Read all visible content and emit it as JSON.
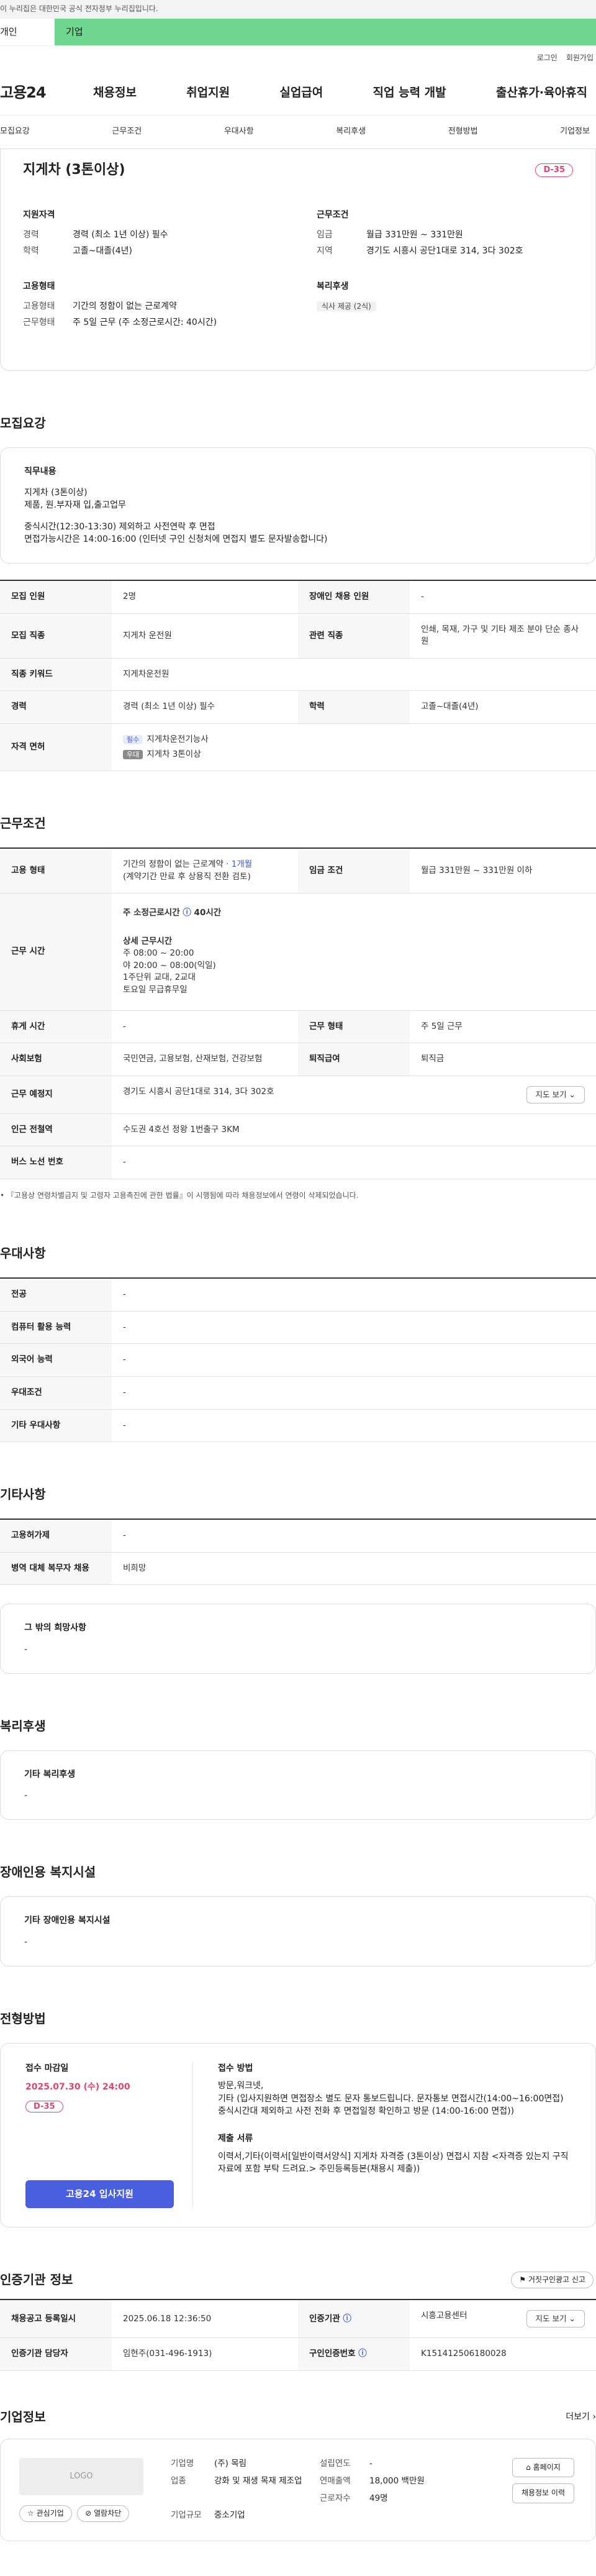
{
  "gov_banner": "이 누리집은 대한민국 공식 전자정부 누리집입니다.",
  "top_tabs": [
    "개인",
    "기업"
  ],
  "util": [
    "로그인",
    "회원가입"
  ],
  "logo": "고용24",
  "gnb": [
    "채용정보",
    "취업지원",
    "실업급여",
    "직업 능력 개발",
    "출산휴가·육아휴직"
  ],
  "subnav": [
    "모집요강",
    "근무조건",
    "우대사항",
    "복리후생",
    "전형방법",
    "기업정보"
  ],
  "summary": {
    "title": "지게차 (3톤이상)",
    "dday": "D-35",
    "req_title": "지원자격",
    "req": [
      {
        "k": "경력",
        "v": "경력 (최소 1년 이상) 필수"
      },
      {
        "k": "학력",
        "v": "고졸~대졸(4년)"
      }
    ],
    "cond_title": "근무조건",
    "cond": [
      {
        "k": "임금",
        "v": "월급 331만원 ~ 331만원"
      },
      {
        "k": "지역",
        "v": "경기도 시흥시 공단1대로 314, 3다 302호"
      }
    ],
    "emp_title": "고용형태",
    "emp": [
      {
        "k": "고용형태",
        "v": "기간의 정함이 없는 근로계약"
      },
      {
        "k": "근무형태",
        "v": "주 5일 근무 (주 소정근로시간: 40시간)"
      }
    ],
    "welfare_title": "복리후생",
    "welfare_chip": "식사 제공 (2식)"
  },
  "recruit": {
    "title": "모집요강",
    "duty_title": "직무내용",
    "duty_lines": [
      "지게차 (3톤이상)",
      "제품, 원.부자재  입,출고업무",
      "",
      "중식시간(12:30-13:30) 제외하고 사전연락 후 면접",
      "면접가능시간은 14:00-16:00 (인터넷 구인 신청처에 면접지 별도 문자발송합니다)"
    ],
    "rows": [
      {
        "k1": "모집 인원",
        "v1": "2명",
        "k2": "장애인 채용 인원",
        "v2": "-"
      },
      {
        "k1": "모집 직종",
        "v1": "지게차 운전원",
        "k2": "관련 직종",
        "v2": "인쇄, 목재, 가구 및 기타 제조 분야 단순 종사원"
      },
      {
        "k1": "직종 키워드",
        "v1": "지게차운전원"
      },
      {
        "k1": "경력",
        "v1": "경력 (최소 1년 이상) 필수",
        "k2": "학력",
        "v2": "고졸~대졸(4년)"
      }
    ],
    "license_label": "자격 면허",
    "license": [
      {
        "tag": "필수",
        "name": "지게차운전기능사"
      },
      {
        "tag": "우대",
        "name": "지게차 3톤이상"
      }
    ]
  },
  "work": {
    "title": "근무조건",
    "emp_label": "고용 형태",
    "emp_v1": "기간의 정함이 없는 근로계약",
    "emp_v1_blue": " · 1개월",
    "emp_v2": "(계약기간 만료 후 상용직 전환 검토)",
    "wage_label": "임금 조건",
    "wage": "월급 331만원 ~ 331만원 이하",
    "hours_label": "근무 시간",
    "hours_head": "주 소정근로시간",
    "hours_head2": "40시간",
    "hours_detail_title": "상세 근무시간",
    "hours_lines": [
      "주 08:00 ~ 20:00",
      "야 20:00 ~ 08:00(익일)",
      "1주단위 교대, 2교대",
      "토요일 무급휴무일"
    ],
    "rows": [
      {
        "k1": "휴게 시간",
        "v1": "-",
        "k2": "근무 형태",
        "v2": "주 5일 근무"
      },
      {
        "k1": "사회보험",
        "v1": "국민연금, 고용보험, 산재보험, 건강보험",
        "k2": "퇴직급여",
        "v2": "퇴직금"
      }
    ],
    "place_label": "근무 예정지",
    "place": "경기도 시흥시 공단1대로 314, 3다 302호",
    "map_btn": "지도 보기",
    "subway_label": "인근 전철역",
    "subway": "수도권 4호선 정왕 1번출구 3KM",
    "bus_label": "버스 노선 번호",
    "bus": "-",
    "note": "『고용상 연령차별금지 및 고령자 고용촉진에 관한 법률』이 시행됨에 따라 채용정보에서 연령이 삭제되었습니다."
  },
  "prefer": {
    "title": "우대사항",
    "rows": [
      {
        "k": "전공",
        "v": "-"
      },
      {
        "k": "컴퓨터 활용 능력",
        "v": "-"
      },
      {
        "k": "외국어 능력",
        "v": "-"
      },
      {
        "k": "우대조건",
        "v": "-"
      },
      {
        "k": "기타 우대사항",
        "v": "-"
      }
    ]
  },
  "etc": {
    "title": "기타사항",
    "rows": [
      {
        "k": "고용허가제",
        "v": "-"
      },
      {
        "k": "병역 대체 복무자 채용",
        "v": "비희망"
      }
    ],
    "box_title": "그 밖의 희망사항",
    "box_value": "-"
  },
  "welfare": {
    "title": "복리후생",
    "box_title": "기타 복리후생",
    "box_value": "-"
  },
  "disabled": {
    "title": "장애인용 복지시설",
    "box_title": "기타 장애인용 복지시설",
    "box_value": "-"
  },
  "apply": {
    "title": "전형방법",
    "deadline_label": "접수 마감일",
    "deadline": "2025.07.30 (수) 24:00",
    "dday": "D-35",
    "button": "고용24 입사지원",
    "method_title": "접수 방법",
    "method_lines": [
      "방문,워크넷,",
      "기타 (입사지원하면 면접장소 별도 문자 통보드립니다. 문자통보 면접시간(14:00~16:00면접) 중식시간대 제외하고 사전 전화 후 면접일정 확인하고 방문 (14:00-16:00 면접))"
    ],
    "docs_title": "제출 서류",
    "docs_lines": [
      "이력서,기타(이력서[일반이력서양식] 지게차 자격증 (3톤이상) 면접시 지참 <자격증 있는지 구직 자료에 포함 부탁 드려요.> 주민등록등본(채용시 제출))"
    ]
  },
  "cert": {
    "title": "인증기관 정보",
    "report_btn": "거짓구인광고 신고",
    "reg_label": "채용공고 등록일시",
    "reg": "2025.06.18 12:36:50",
    "org_label": "인증기관",
    "org": "시흥고용센터",
    "map_btn": "지도 보기",
    "mgr_label": "인증기관 담당자",
    "mgr": "임현주(031-496-1913)",
    "no_label": "구인인증번호",
    "no": "K151412506180028"
  },
  "company": {
    "title": "기업정보",
    "more": "더보기",
    "logo": "LOGO",
    "fav": "관심기업",
    "block": "열람차단",
    "grid": [
      {
        "k": "기업명",
        "v": "(주) 목림"
      },
      {
        "k": "설립연도",
        "v": "-"
      },
      {
        "k": "업종",
        "v": "강화 및 재생 목재 제조업"
      },
      {
        "k": "연매출액",
        "v": "18,000 백만원"
      },
      {
        "k": "",
        "v": ""
      },
      {
        "k": "근로자수",
        "v": "49명"
      },
      {
        "k": "기업규모",
        "v": "중소기업"
      },
      {
        "k": "",
        "v": ""
      }
    ],
    "homepage": "홈페이지",
    "history": "채용정보 이력"
  }
}
